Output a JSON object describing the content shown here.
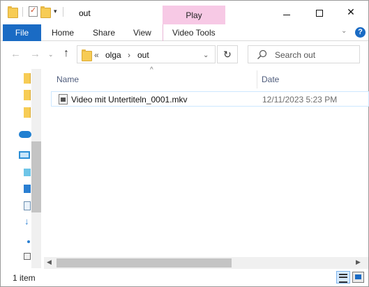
{
  "window": {
    "title": "out",
    "contextual_tab": "Play"
  },
  "ribbon": {
    "file": "File",
    "home": "Home",
    "share": "Share",
    "view": "View",
    "video_tools": "Video Tools"
  },
  "address": {
    "overflow": "«",
    "crumbs": [
      "olga",
      "out"
    ],
    "separator": "›"
  },
  "search": {
    "placeholder": "Search out"
  },
  "columns": {
    "name": "Name",
    "date": "Date"
  },
  "files": [
    {
      "name": "Video mit Untertiteln_0001.mkv",
      "date": "12/11/2023 5:23 PM"
    }
  ],
  "status": {
    "count": "1 item"
  },
  "colors": {
    "accent": "#1a6bc4",
    "context_tab": "#f7c9e5",
    "selection_border": "#cde8ff"
  }
}
